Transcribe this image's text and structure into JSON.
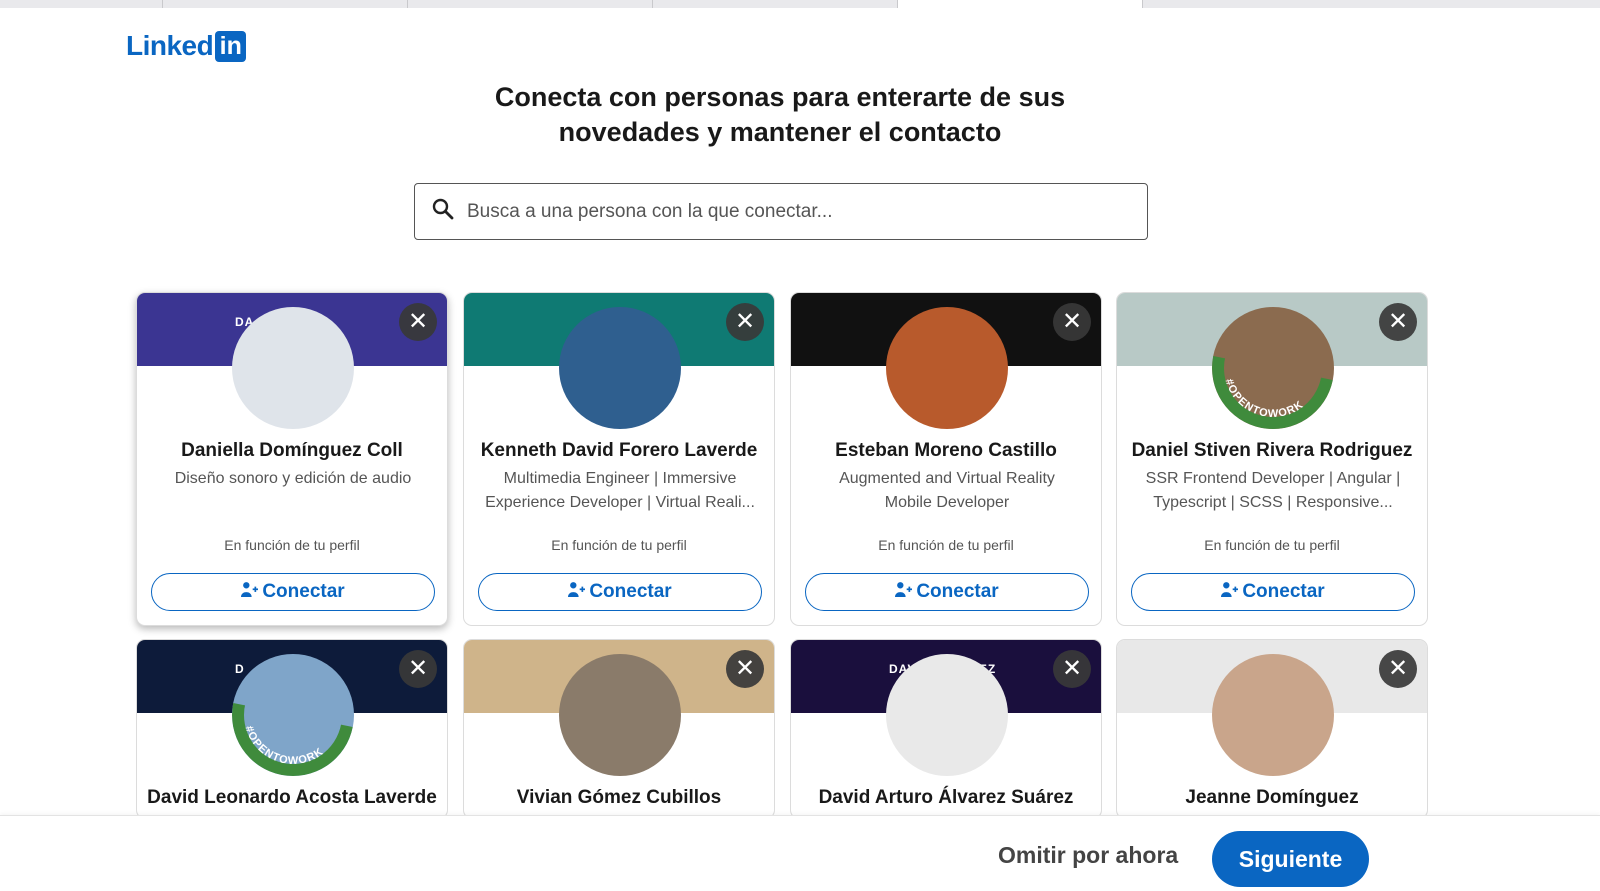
{
  "brand": {
    "word": "Linked",
    "box": "in"
  },
  "headline": {
    "line1": "Conecta con personas para enterarte de sus",
    "line2": "novedades y mantener el contacto"
  },
  "search": {
    "placeholder": "Busca a una persona con la que conectar..."
  },
  "cards": [
    {
      "name": "Daniella Domínguez Coll",
      "headline_l1": "Diseño sonoro y edición de audio",
      "headline_l2": "",
      "reason": "En función de tu perfil",
      "connect": "Conectar",
      "banner_label": "DA            OLL",
      "banner": "#3b3592",
      "avatar": "#dfe4ea",
      "open_to_work": false
    },
    {
      "name": "Kenneth David Forero Laverde",
      "headline_l1": "Multimedia Engineer | Immersive",
      "headline_l2": "Experience Developer | Virtual Reali...",
      "reason": "En función de tu perfil",
      "connect": "Conectar",
      "banner_label": "",
      "banner": "#0f7a73",
      "avatar": "#2f5f8f",
      "open_to_work": false
    },
    {
      "name": "Esteban Moreno Castillo",
      "headline_l1": "Augmented and Virtual Reality",
      "headline_l2": "Mobile Developer",
      "reason": "En función de tu perfil",
      "connect": "Conectar",
      "banner_label": "",
      "banner": "#111111",
      "avatar": "#b85a2c",
      "open_to_work": false
    },
    {
      "name": "Daniel Stiven Rivera Rodriguez",
      "headline_l1": "SSR Frontend Developer | Angular |",
      "headline_l2": "Typescript | SCSS | Responsive...",
      "reason": "En función de tu perfil",
      "connect": "Conectar",
      "banner_label": "",
      "banner": "#b8c9c6",
      "avatar": "#8b6b4f",
      "open_to_work": true
    },
    {
      "name": "David Leonardo Acosta Laverde",
      "headline_l1": "",
      "headline_l2": "",
      "reason": "",
      "connect": "",
      "banner_label": "D            FA",
      "banner": "#0d1b3a",
      "avatar": "#7fa5c9",
      "open_to_work": true
    },
    {
      "name": "Vivian Gómez Cubillos",
      "headline_l1": "",
      "headline_l2": "",
      "reason": "",
      "connect": "",
      "banner_label": "",
      "banner": "#cfb48a",
      "avatar": "#8a7b6a",
      "open_to_work": false
    },
    {
      "name": "David Arturo Álvarez Suárez",
      "headline_l1": "",
      "headline_l2": "",
      "reason": "",
      "connect": "",
      "banner_label": "DAVID ALVAREZ",
      "banner": "#1a0f3d",
      "avatar": "#e9e9e9",
      "open_to_work": false
    },
    {
      "name": "Jeanne Domínguez",
      "headline_l1": "",
      "headline_l2": "",
      "reason": "",
      "connect": "",
      "banner_label": "",
      "banner": "#e8e8e8",
      "avatar": "#c9a58b",
      "open_to_work": false
    }
  ],
  "open_to_work_label": "#OPENTOWORK",
  "dismiss_glyph": "✕",
  "footer": {
    "skip": "Omitir por ahora",
    "next": "Siguiente"
  },
  "colors": {
    "accent": "#0a66c2",
    "open_to_work": "#3f8b3c"
  }
}
